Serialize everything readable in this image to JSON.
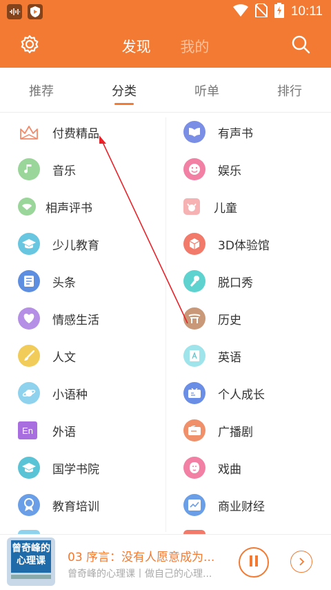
{
  "status_bar": {
    "time": "10:11"
  },
  "header": {
    "settings_icon": "gear-icon",
    "search_icon": "search-icon",
    "tab_discover": "发现",
    "tab_mine": "我的"
  },
  "subtabs": [
    "推荐",
    "分类",
    "听单",
    "排行"
  ],
  "subtab_active": "分类",
  "categories_left": [
    "付费精品",
    "音乐",
    "相声评书",
    "少儿教育",
    "头条",
    "情感生活",
    "人文",
    "小语种",
    "外语",
    "国学书院",
    "教育培训"
  ],
  "categories_right": [
    "有声书",
    "娱乐",
    "儿童",
    "3D体验馆",
    "脱口秀",
    "历史",
    "英语",
    "个人成长",
    "广播剧",
    "戏曲",
    "商业财经"
  ],
  "player": {
    "cover_text": "曾奇峰的心理课",
    "track_title": "03 序言：没有人愿意成为...",
    "track_subtitle": "曾奇峰的心理课丨做自己的心理..."
  },
  "colors": {
    "accent": "#f27a32"
  }
}
